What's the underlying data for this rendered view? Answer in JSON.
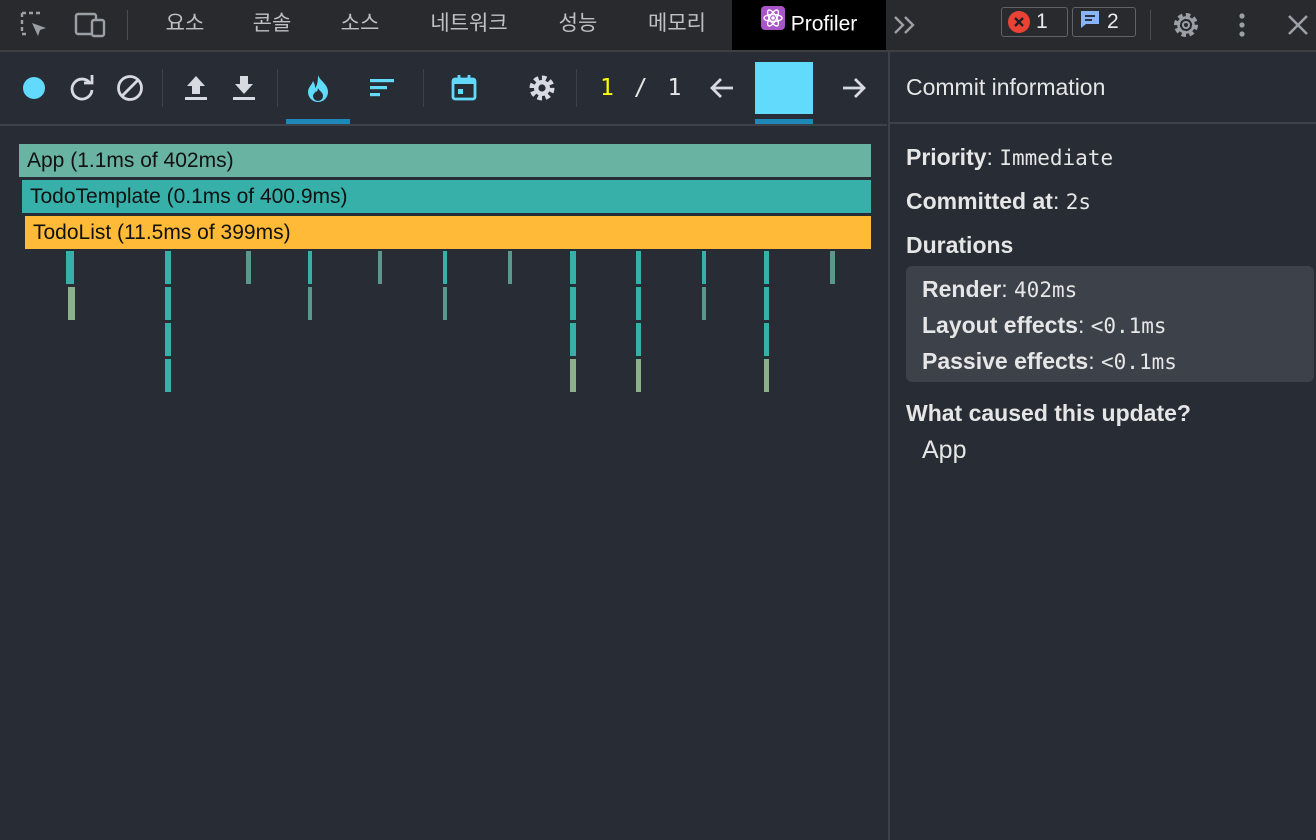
{
  "topbar": {
    "tabs": [
      "요소",
      "콘솔",
      "소스",
      "네트워크",
      "성능",
      "메모리"
    ],
    "active_tab": "Profiler",
    "error_count": "1",
    "message_count": "2",
    "more_tabs_icon": "double-chevron-right-icon"
  },
  "toolbar": {
    "commit_current": "1",
    "commit_separator": "/",
    "commit_total": "1",
    "icons": [
      "record-icon",
      "reload-icon",
      "clear-icon",
      "upload-icon",
      "download-icon",
      "flamegraph-icon",
      "ranked-icon",
      "timeline-icon",
      "settings-icon",
      "prev-arrow-icon",
      "next-arrow-icon"
    ]
  },
  "flamegraph": {
    "rows": [
      {
        "label": "App (1.1ms of 402ms)",
        "color": "#69b3a2"
      },
      {
        "label": "TodoTemplate (0.1ms of 400.9ms)",
        "color": "#37b0aa"
      },
      {
        "label": "TodoList (11.5ms of 399ms)",
        "color": "#ffbb38"
      }
    ]
  },
  "commit_info": {
    "title": "Commit information",
    "priority_label": "Priority",
    "priority_value": "Immediate",
    "committed_label": "Committed at",
    "committed_value": "2s",
    "durations_label": "Durations",
    "render_label": "Render",
    "render_value": "402ms",
    "layout_label": "Layout effects",
    "layout_value": "<0.1ms",
    "passive_label": "Passive effects",
    "passive_value": "<0.1ms",
    "cause_label": "What caused this update?",
    "cause_value": "App"
  },
  "colors": {
    "accent": "#61dafb",
    "commit_current": "#ffff00",
    "error": "#ea4335",
    "message": "#8ab4f8"
  }
}
